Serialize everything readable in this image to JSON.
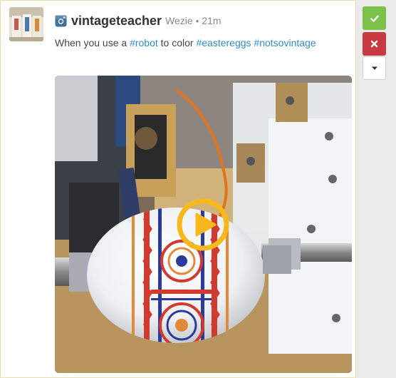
{
  "post": {
    "network_icon": "instagram-icon",
    "username": "vintageteacher",
    "source": "Wezie",
    "separator": "•",
    "time": "21m",
    "caption": {
      "prefix": "When you use a ",
      "tag1": "#robot",
      "middle": " to color ",
      "tag2": "#eastereggs",
      "space": " ",
      "tag3": "#notsovintage"
    },
    "media": {
      "type": "video",
      "play_icon": "play-icon",
      "play_color": "#f6b81c"
    }
  },
  "actions": {
    "approve_icon": "check-icon",
    "reject_icon": "close-icon",
    "more_icon": "caret-down-icon",
    "approve_color": "#7cc24a",
    "reject_color": "#c93a40"
  },
  "colors": {
    "link": "#2e8ccf",
    "card_border": "#efd9a8",
    "sidebar": "#ebebeb"
  }
}
